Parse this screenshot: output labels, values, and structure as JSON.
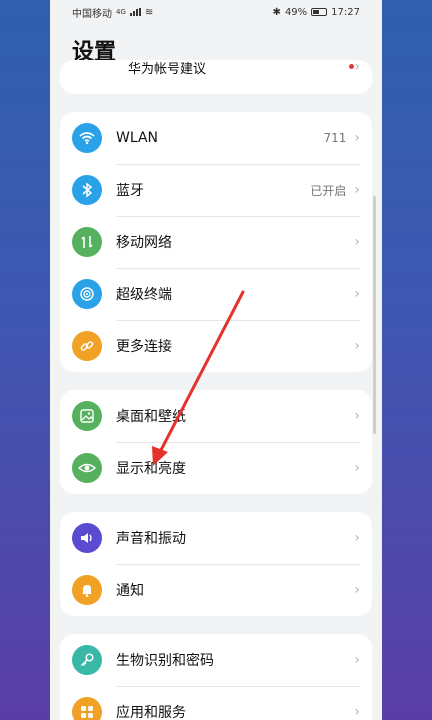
{
  "status": {
    "carrier": "中国移动",
    "network": "4G",
    "bluetooth": "✱",
    "battery": "49%",
    "time": "17:27"
  },
  "page": {
    "title": "设置"
  },
  "top_partial": {
    "label": "华为帐号建议"
  },
  "sections": [
    {
      "rows": [
        {
          "label": "WLAN",
          "value": "711",
          "icon": "wifi-icon",
          "color": "#2aa2e8"
        },
        {
          "label": "蓝牙",
          "value": "已开启",
          "icon": "bluetooth-icon",
          "color": "#2aa2e8"
        },
        {
          "label": "移动网络",
          "value": "",
          "icon": "mobile-network-icon",
          "color": "#56b15f"
        },
        {
          "label": "超级终端",
          "value": "",
          "icon": "super-device-icon",
          "color": "#2aa2e8"
        },
        {
          "label": "更多连接",
          "value": "",
          "icon": "link-icon",
          "color": "#f1a124"
        }
      ]
    },
    {
      "rows": [
        {
          "label": "桌面和壁纸",
          "value": "",
          "icon": "wallpaper-icon",
          "color": "#56b15f"
        },
        {
          "label": "显示和亮度",
          "value": "",
          "icon": "eye-icon",
          "color": "#56b15f"
        }
      ]
    },
    {
      "rows": [
        {
          "label": "声音和振动",
          "value": "",
          "icon": "sound-icon",
          "color": "#5a4bd1"
        },
        {
          "label": "通知",
          "value": "",
          "icon": "bell-icon",
          "color": "#f1a124"
        }
      ]
    },
    {
      "rows": [
        {
          "label": "生物识别和密码",
          "value": "",
          "icon": "key-icon",
          "color": "#39b8a6"
        },
        {
          "label": "应用和服务",
          "value": "",
          "icon": "apps-icon",
          "color": "#f1a124"
        }
      ]
    }
  ],
  "annotation": {
    "color": "#e5322d"
  }
}
